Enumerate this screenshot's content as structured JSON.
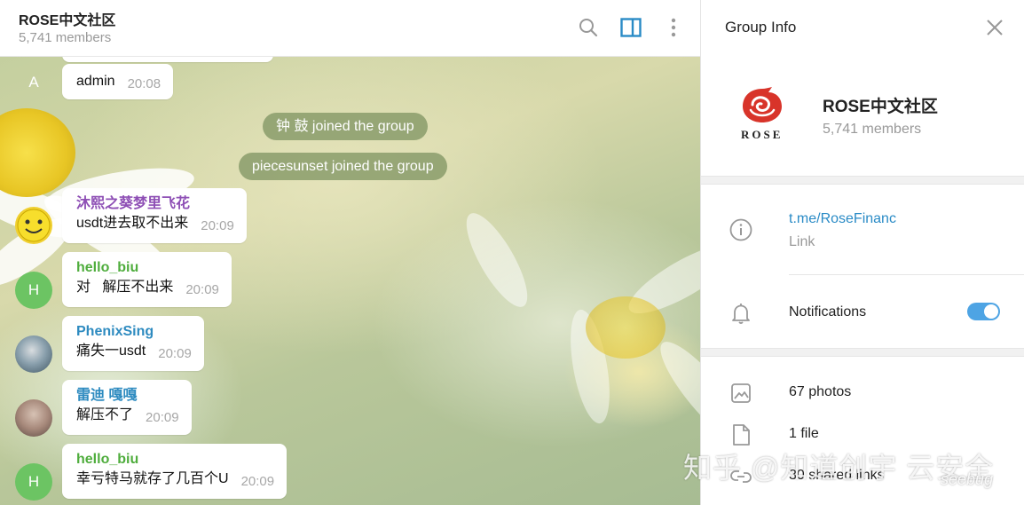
{
  "chat": {
    "title": "ROSE中文社区",
    "members": "5,741 members",
    "icons": [
      "search-icon",
      "sidebar-toggle-icon",
      "more-vertical-icon"
    ],
    "accent": "#2a8bc6",
    "messages": [
      {
        "type": "message",
        "avatar_letter": "A",
        "avatar_color": "#5fc0d0",
        "sender": "",
        "sender_color": "",
        "text": "admin",
        "time": "20:08"
      },
      {
        "type": "service",
        "text": "钟 鼓 joined the group"
      },
      {
        "type": "service",
        "text": "piecesunset joined the group"
      },
      {
        "type": "message",
        "avatar_letter": "",
        "avatar_color": "#f0d030",
        "avatar_kind": "smiley",
        "sender": "沐熙之葵梦里飞花",
        "sender_color": "#8e4fb5",
        "text": "usdt进去取不出来",
        "time": "20:09"
      },
      {
        "type": "message",
        "avatar_letter": "H",
        "avatar_color": "#6cc463",
        "sender": "hello_biu",
        "sender_color": "#4fad3d",
        "text": "对   解压不出来",
        "time": "20:09"
      },
      {
        "type": "message",
        "avatar_letter": "",
        "avatar_color": "#6f8a9a",
        "avatar_kind": "photo",
        "sender": "PhenixSing",
        "sender_color": "#2e8bc0",
        "text": "痛失一usdt",
        "time": "20:09"
      },
      {
        "type": "message",
        "avatar_letter": "",
        "avatar_color": "#a8928a",
        "avatar_kind": "photo",
        "sender": "雷迪 嘎嘎",
        "sender_color": "#2e8bc0",
        "text": "解压不了",
        "time": "20:09"
      },
      {
        "type": "message",
        "avatar_letter": "H",
        "avatar_color": "#6cc463",
        "sender": "hello_biu",
        "sender_color": "#4fad3d",
        "text": "幸亏特马就存了几百个U",
        "time": "20:09"
      }
    ]
  },
  "info": {
    "title": "Group Info",
    "logo_text": "ROSE",
    "logo_color": "#d8342a",
    "group_name": "ROSE中文社区",
    "group_members": "5,741 members",
    "link": "t.me/RoseFinanc",
    "link_label": "Link",
    "notifications_label": "Notifications",
    "notifications_on": true,
    "media": {
      "photos": "67 photos",
      "files": "1 file",
      "links": "30 shared links"
    }
  },
  "watermark": {
    "main": "知乎 @知道创宇 云安全",
    "secondary": "seebug"
  }
}
